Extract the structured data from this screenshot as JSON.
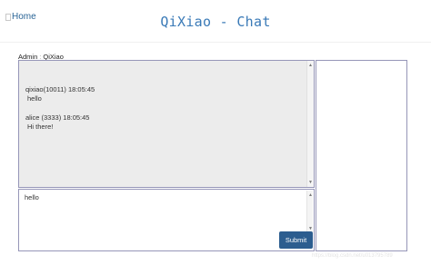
{
  "header": {
    "home_label": "Home",
    "title": "QiXiao - Chat"
  },
  "breadcrumb": {
    "user": "Admin",
    "separator": ":",
    "room": "QiXiao"
  },
  "messages": [
    {
      "meta": "qixiao(10011) 18:05:45",
      "text": "hello"
    },
    {
      "meta": "alice (3333) 18:05:45",
      "text": "Hi there!"
    }
  ],
  "composer": {
    "value": "hello",
    "submit_label": "Submit"
  },
  "watermark": "https://blog.csdn.net/u013795789",
  "colors": {
    "title": "#3a7ab7",
    "submit_bg": "#2c5d8f",
    "chat_bg": "#ececec",
    "border": "#9696b8"
  }
}
